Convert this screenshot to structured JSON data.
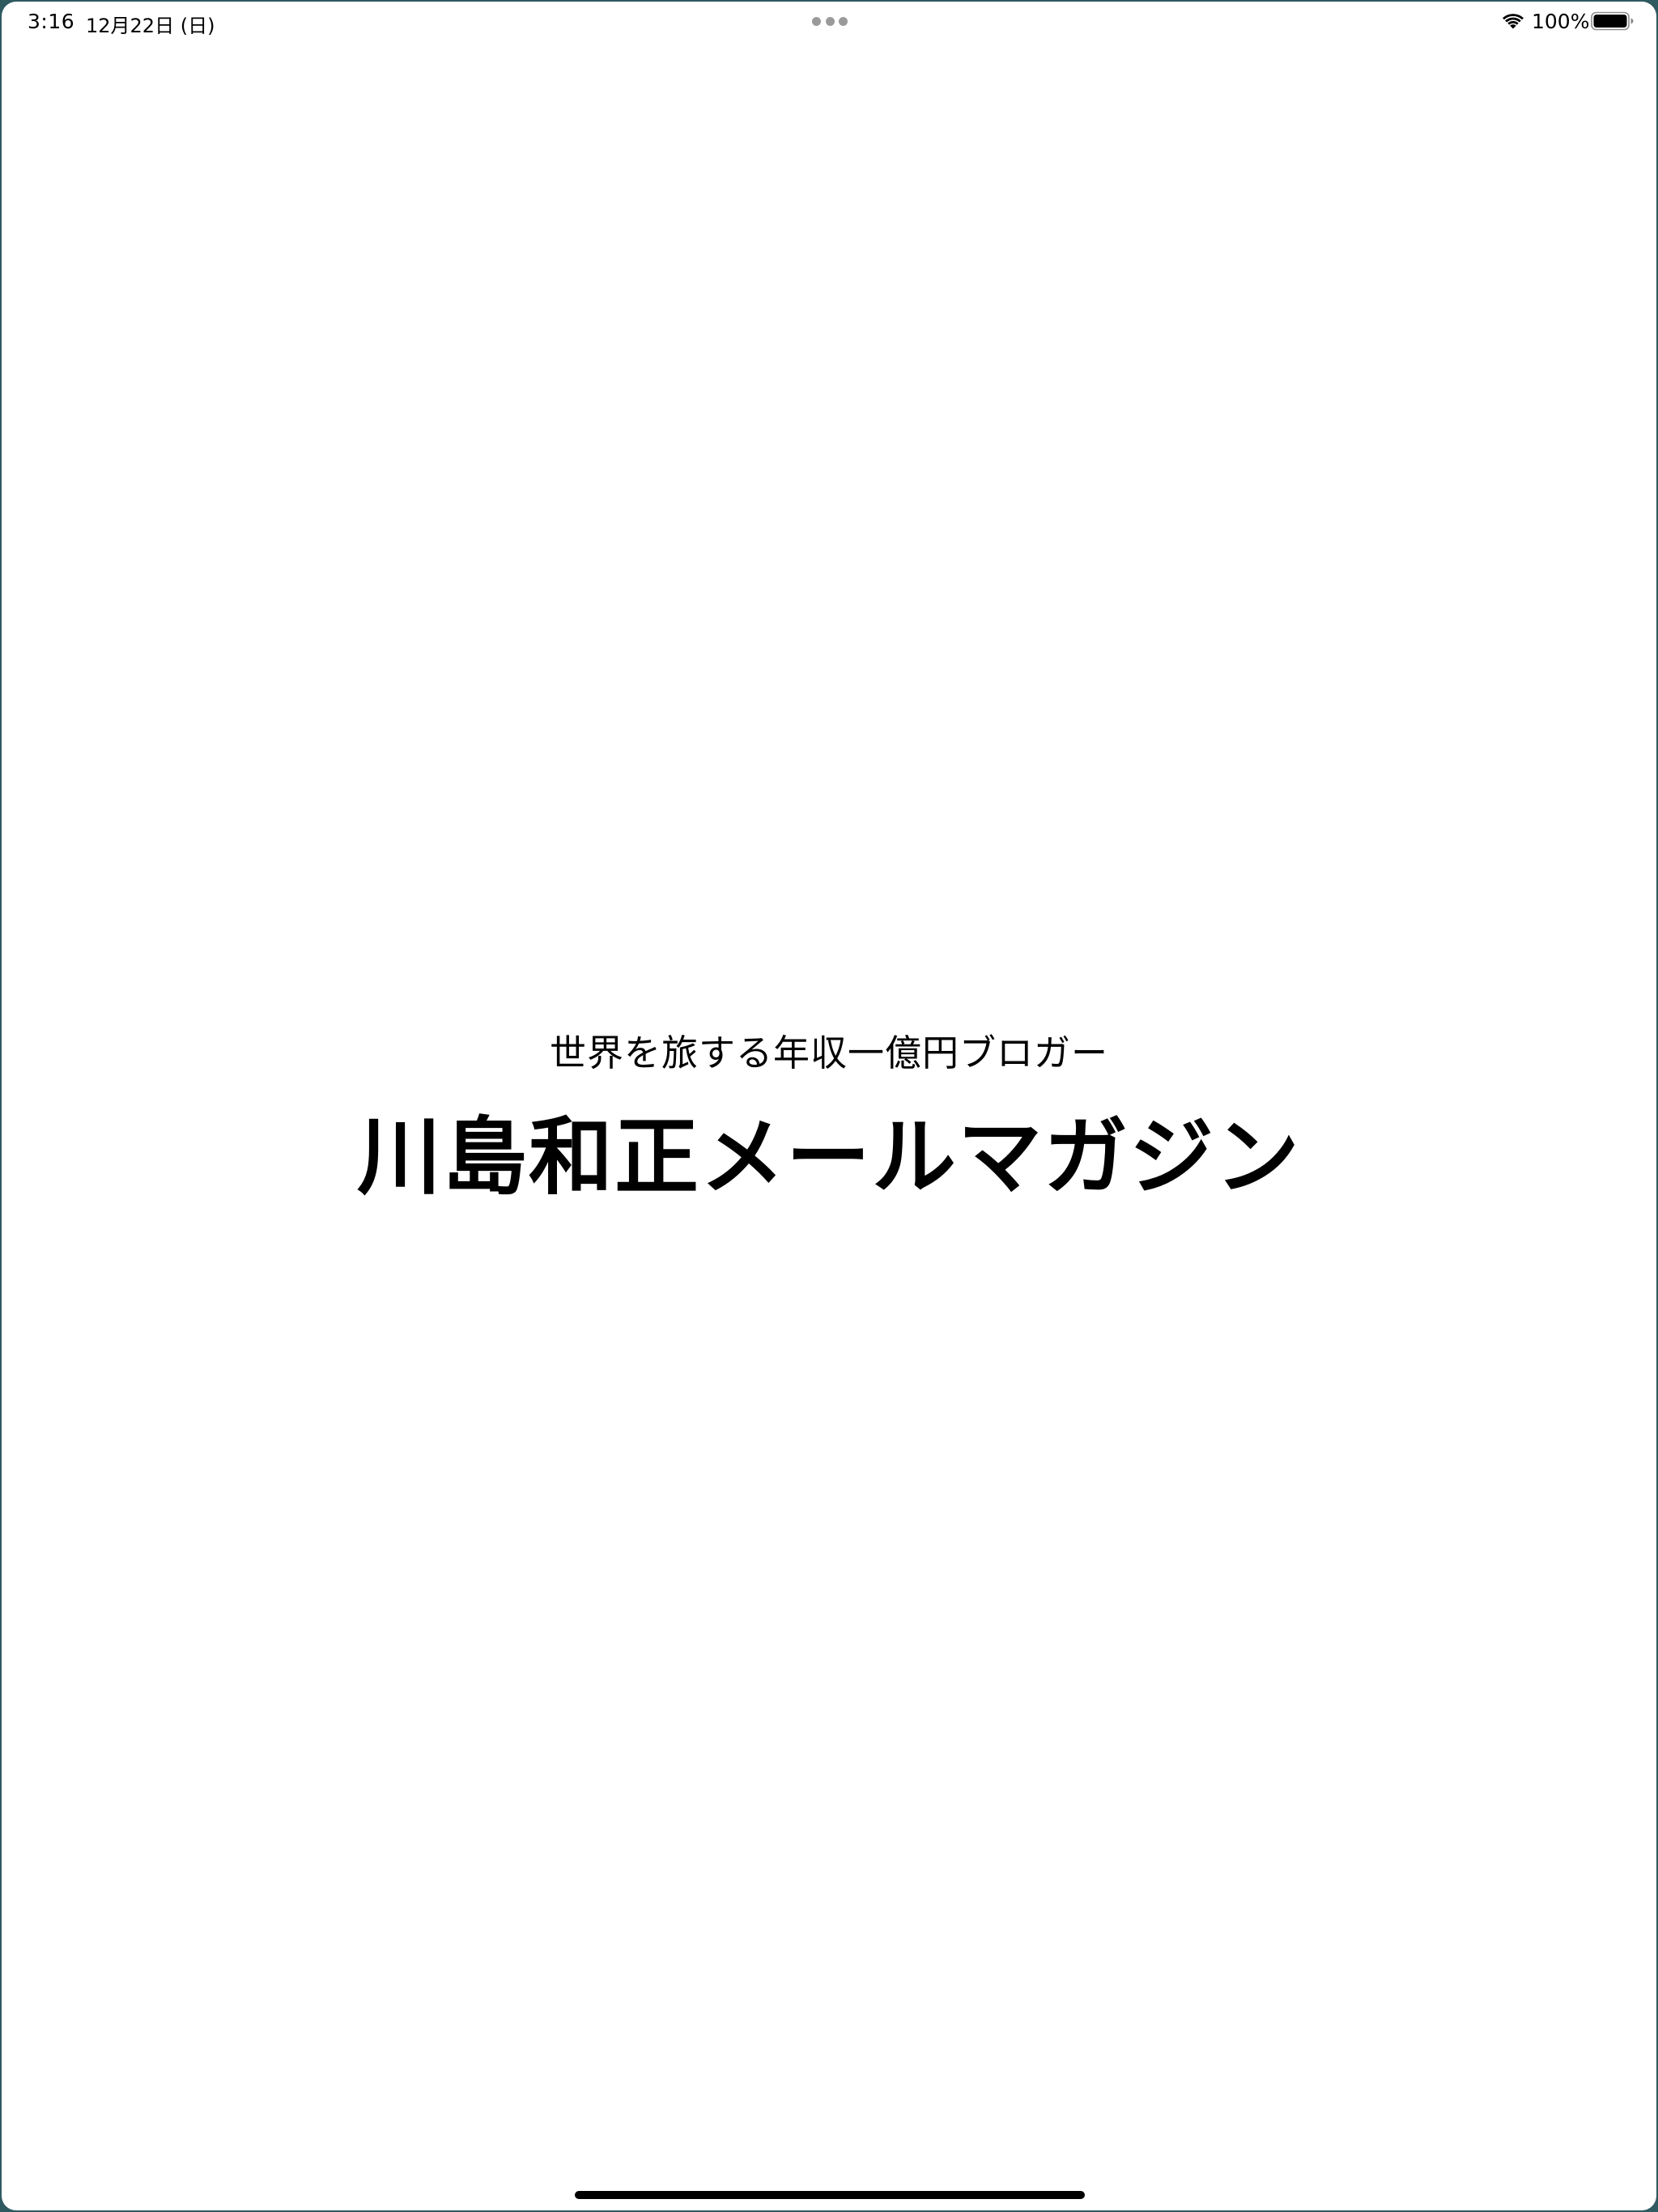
{
  "status_bar": {
    "time": "3:16",
    "date": "12月22日 (日)",
    "battery_percent": "100%",
    "battery_level": 1.0,
    "wifi_icon": "wifi-icon",
    "battery_icon": "battery-full-icon"
  },
  "main": {
    "subtitle": "世界を旅する年収一億円ブロガー",
    "title": "川島和正メールマガジン"
  },
  "colors": {
    "background": "#ffffff",
    "text": "#000000",
    "frame": "#2f5a60"
  }
}
